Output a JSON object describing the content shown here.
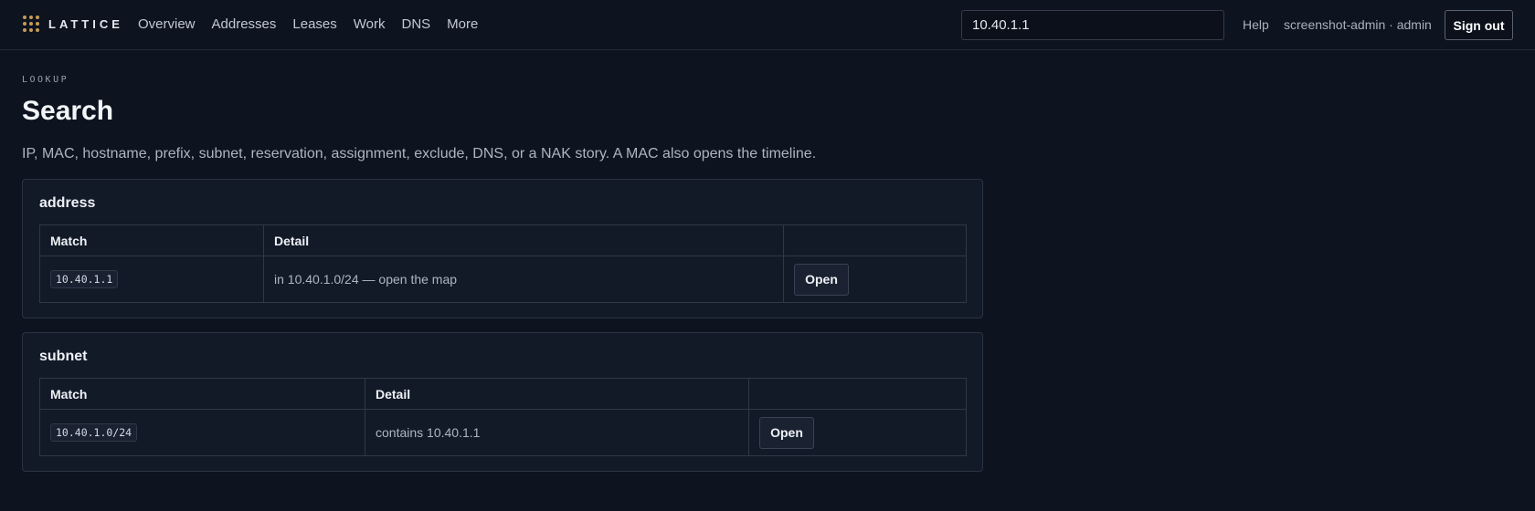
{
  "brand": {
    "name": "LATTICE"
  },
  "nav": {
    "items": [
      {
        "label": "Overview"
      },
      {
        "label": "Addresses"
      },
      {
        "label": "Leases"
      },
      {
        "label": "Work"
      },
      {
        "label": "DNS"
      },
      {
        "label": "More"
      }
    ]
  },
  "search": {
    "value": "10.40.1.1"
  },
  "header": {
    "help_label": "Help",
    "user_label": "screenshot-admin · admin",
    "signout_label": "Sign out"
  },
  "page": {
    "eyebrow": "LOOKUP",
    "title": "Search",
    "description": "IP, MAC, hostname, prefix, subnet, reservation, assignment, exclude, DNS, or a NAK story. A MAC also opens the timeline."
  },
  "results": [
    {
      "title": "address",
      "columns": [
        "Match",
        "Detail",
        ""
      ],
      "rows": [
        {
          "match": "10.40.1.1",
          "detail": "in 10.40.1.0/24 — open the map",
          "action": "Open"
        }
      ]
    },
    {
      "title": "subnet",
      "columns": [
        "Match",
        "Detail",
        ""
      ],
      "rows": [
        {
          "match": "10.40.1.0/24",
          "detail": "contains 10.40.1.1",
          "action": "Open"
        }
      ]
    }
  ],
  "colors": {
    "background": "#0d131f",
    "card": "#121a28",
    "accent": "#c79a55"
  }
}
